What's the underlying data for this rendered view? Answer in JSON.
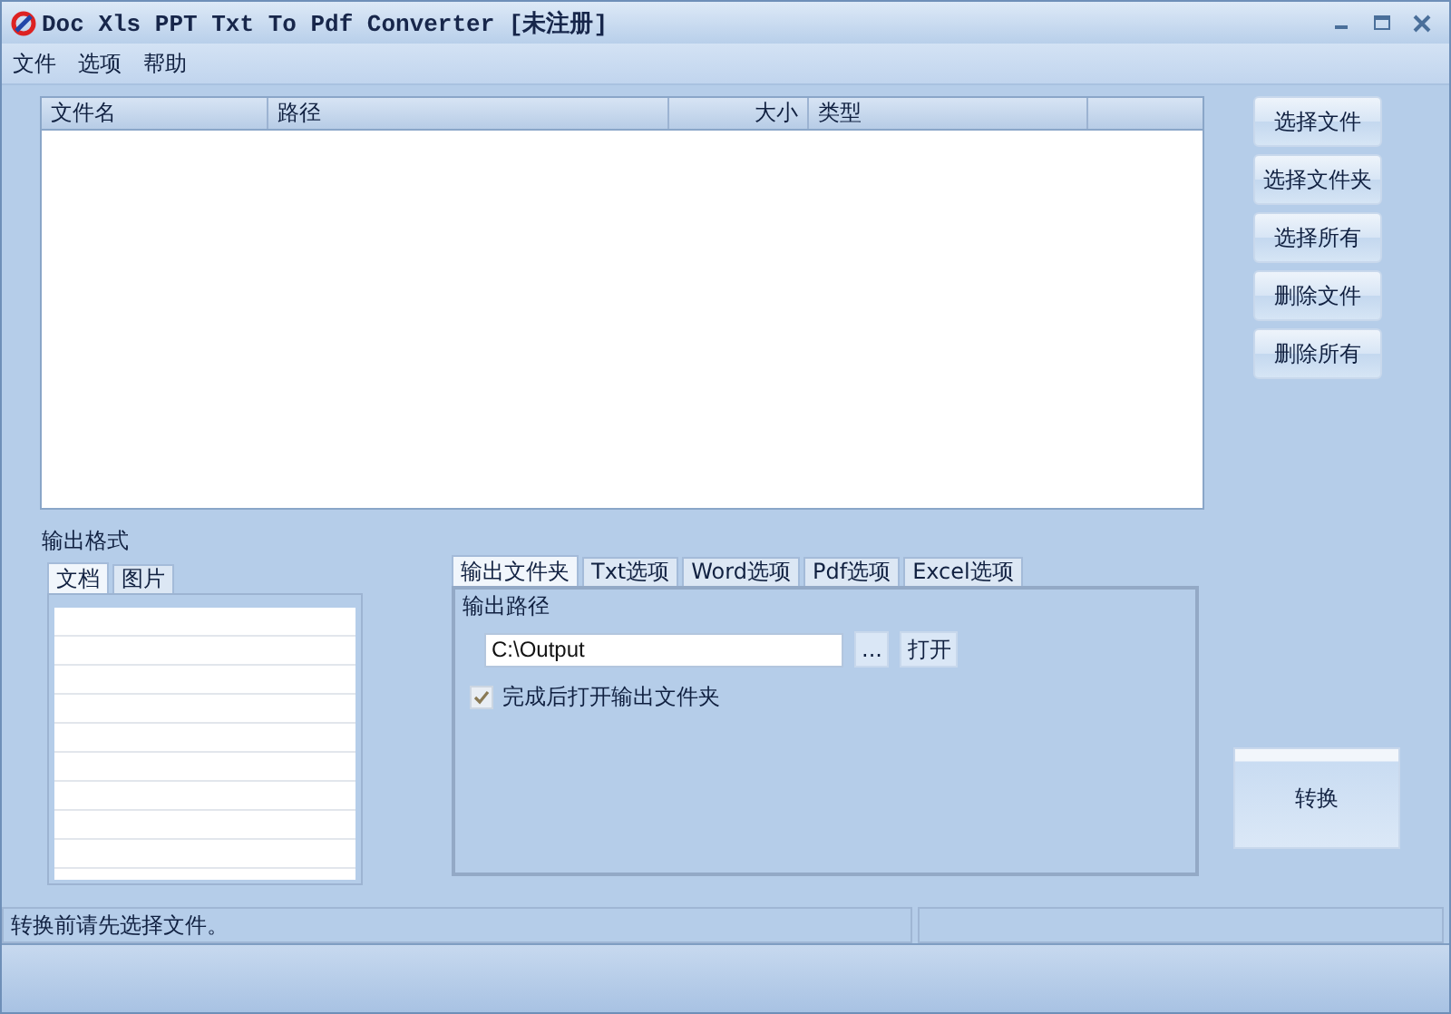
{
  "window": {
    "title": "Doc Xls PPT Txt To Pdf Converter [未注册]"
  },
  "menu": [
    {
      "label": "文件"
    },
    {
      "label": "选项"
    },
    {
      "label": "帮助"
    }
  ],
  "file_table": {
    "columns": [
      {
        "label": "文件名"
      },
      {
        "label": "路径"
      },
      {
        "label": "大小"
      },
      {
        "label": "类型"
      }
    ]
  },
  "side_buttons": [
    "选择文件",
    "选择文件夹",
    "选择所有",
    "删除文件",
    "删除所有"
  ],
  "output_format": {
    "label": "输出格式",
    "tabs": [
      {
        "label": "文档",
        "selected": true
      },
      {
        "label": "图片",
        "selected": false
      }
    ]
  },
  "options": {
    "tabs": [
      {
        "label": "输出文件夹",
        "selected": true
      },
      {
        "label": "Txt选项",
        "selected": false
      },
      {
        "label": "Word选项",
        "selected": false
      },
      {
        "label": "Pdf选项",
        "selected": false
      },
      {
        "label": "Excel选项",
        "selected": false
      }
    ],
    "path_label": "输出路径",
    "path_value": "C:\\Output",
    "browse_button": "...",
    "open_button": "打开",
    "open_after": {
      "label": "完成后打开输出文件夹",
      "checked": true
    }
  },
  "convert_button": "转换",
  "status_bar": {
    "message": "转换前请先选择文件。"
  }
}
